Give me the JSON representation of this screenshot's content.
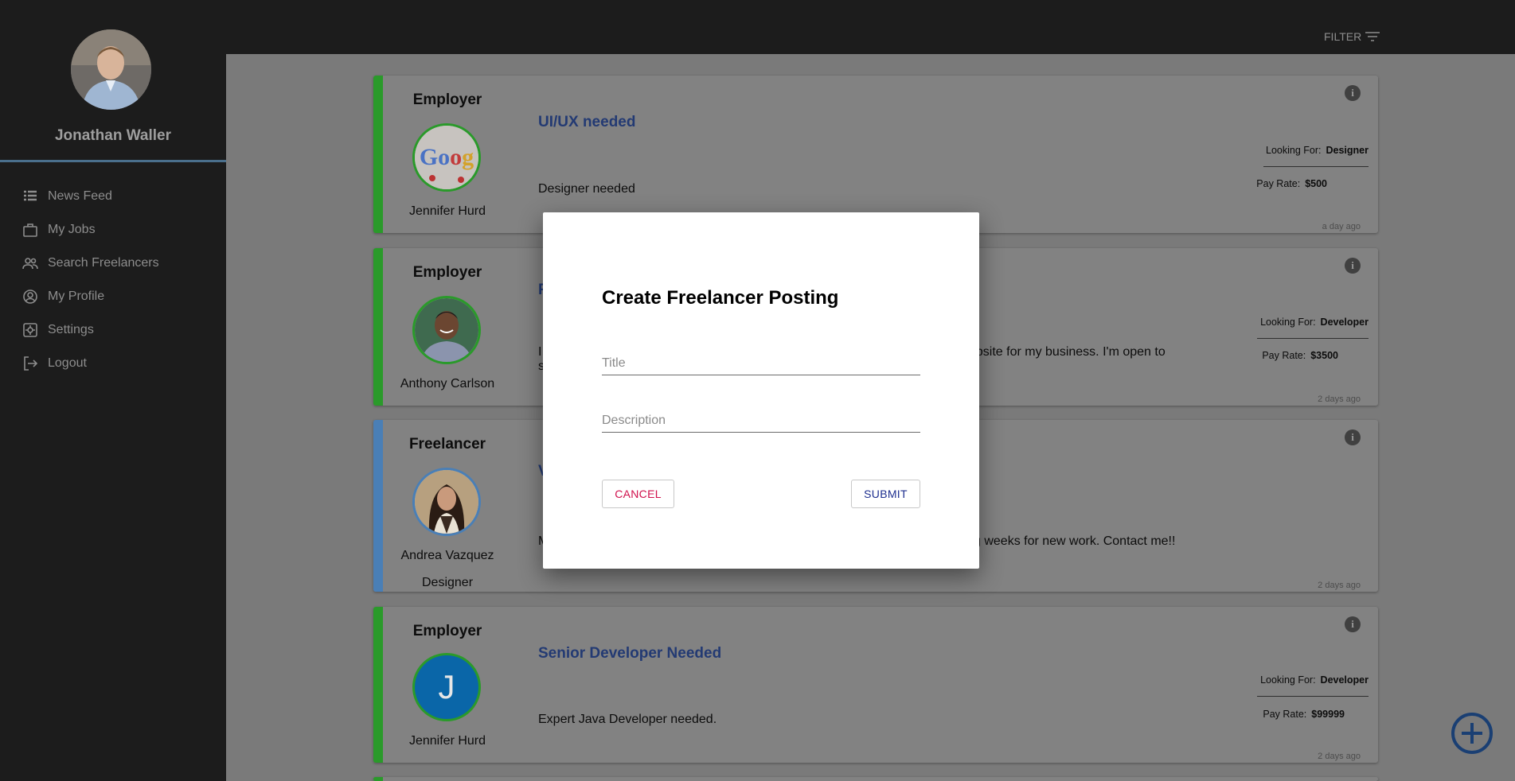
{
  "user": {
    "name": "Jonathan Waller"
  },
  "nav": [
    {
      "label": "News Feed",
      "icon": "list-icon"
    },
    {
      "label": "My Jobs",
      "icon": "briefcase-icon"
    },
    {
      "label": "Search Freelancers",
      "icon": "people-icon"
    },
    {
      "label": "My Profile",
      "icon": "user-circle-icon"
    },
    {
      "label": "Settings",
      "icon": "gear-icon"
    },
    {
      "label": "Logout",
      "icon": "logout-icon"
    }
  ],
  "topbar": {
    "filter_label": "FILTER"
  },
  "posts": [
    {
      "role": "Employer",
      "person": "Jennifer Hurd",
      "title": "UI/UX needed",
      "description": "Designer needed",
      "looking_for_label": "Looking For:",
      "looking_for": "Designer",
      "pay_rate_label": "Pay Rate:",
      "pay_rate": "$500",
      "age": "a day ago"
    },
    {
      "role": "Employer",
      "person": "Anthony Carlson",
      "title": "F",
      "description_left": "I",
      "description_left2": "s",
      "description_right": "ebsite for my business. I'm open to",
      "looking_for_label": "Looking For:",
      "looking_for": "Developer",
      "pay_rate_label": "Pay Rate:",
      "pay_rate": "$3500",
      "age": "2 days ago"
    },
    {
      "role": "Freelancer",
      "person": "Andrea Vazquez",
      "subtitle": "Designer",
      "title": "V",
      "description_left": "M",
      "description_right": "g weeks for new work. Contact me!!",
      "age": "2 days ago"
    },
    {
      "role": "Employer",
      "person": "Jennifer Hurd",
      "initial": "J",
      "title": "Senior Developer Needed",
      "description": "Expert Java Developer needed.",
      "looking_for_label": "Looking For:",
      "looking_for": "Developer",
      "pay_rate_label": "Pay Rate:",
      "pay_rate": "$99999",
      "age": "2 days ago"
    }
  ],
  "modal": {
    "title": "Create Freelancer Posting",
    "title_placeholder": "Title",
    "description_placeholder": "Description",
    "cancel_label": "CANCEL",
    "submit_label": "SUBMIT"
  },
  "colors": {
    "employer": "#2a9a2a",
    "freelancer": "#4a7fb6",
    "cancel": "#d0104c",
    "submit": "#1e2f8f",
    "title_link": "#233a73"
  }
}
